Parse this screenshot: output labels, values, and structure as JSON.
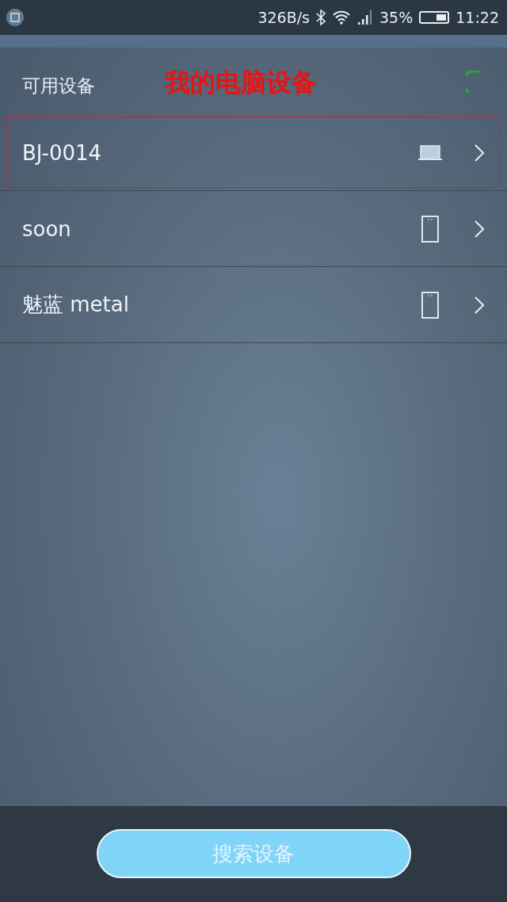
{
  "status_bar": {
    "speed": "326B/s",
    "battery": "35%",
    "time": "11:22"
  },
  "header": {
    "title": "可用设备",
    "annotation": "我的电脑设备",
    "scanning": true
  },
  "devices": [
    {
      "name": "BJ-0014",
      "kind": "laptop",
      "highlighted": true
    },
    {
      "name": "soon",
      "kind": "phone",
      "highlighted": false
    },
    {
      "name": "魅蓝 metal",
      "kind": "phone",
      "highlighted": false
    }
  ],
  "search_button": "搜索设备"
}
